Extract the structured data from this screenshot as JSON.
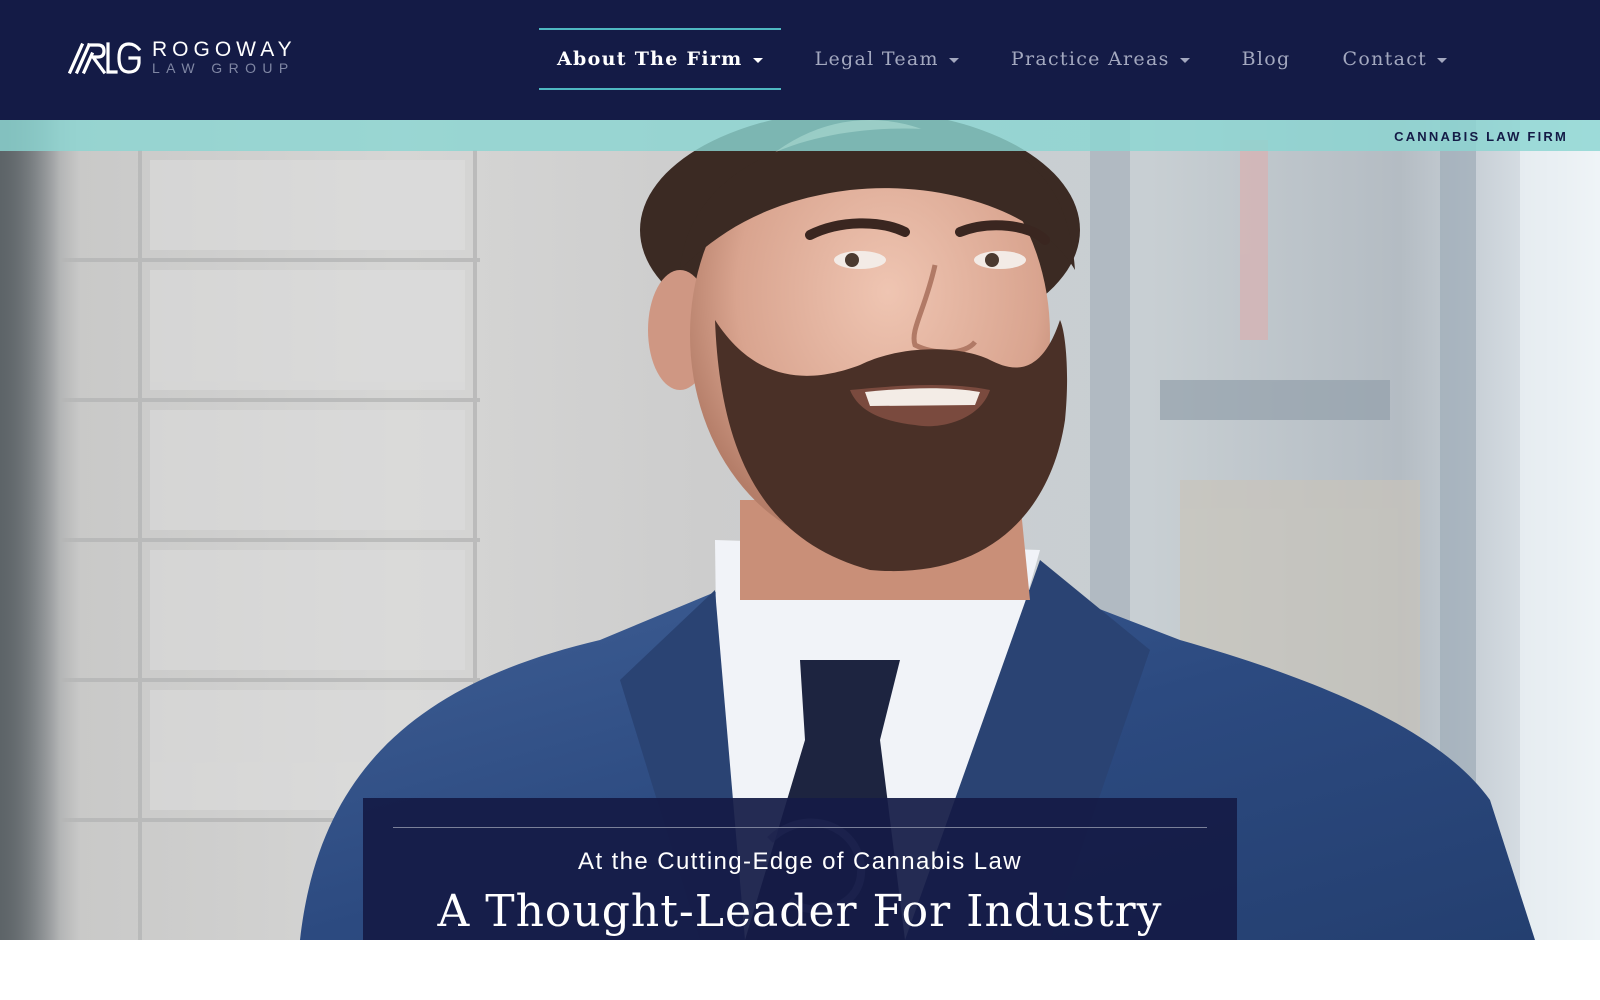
{
  "logo": {
    "mark_icon": "rlg-monogram-icon",
    "name": "ROGOWAY",
    "subtitle": "LAW GROUP"
  },
  "nav": {
    "items": [
      {
        "label": "About The Firm",
        "has_dropdown": true,
        "active": true
      },
      {
        "label": "Legal Team",
        "has_dropdown": true,
        "active": false
      },
      {
        "label": "Practice Areas",
        "has_dropdown": true,
        "active": false
      },
      {
        "label": "Blog",
        "has_dropdown": false,
        "active": false
      },
      {
        "label": "Contact",
        "has_dropdown": true,
        "active": false
      }
    ]
  },
  "ribbon": {
    "label": "CANNABIS LAW FIRM"
  },
  "hero": {
    "image": "bearded-man-in-navy-suit-portrait",
    "subheading": "At the Cutting-Edge of Cannabis Law",
    "heading": "A Thought-Leader For Industry"
  },
  "colors": {
    "header_bg": "#141b46",
    "accent_teal": "#4fb8c1",
    "ribbon_teal": "#8bd6d2",
    "nav_text": "#a3a8bf",
    "nav_active_text": "#ffffff"
  }
}
